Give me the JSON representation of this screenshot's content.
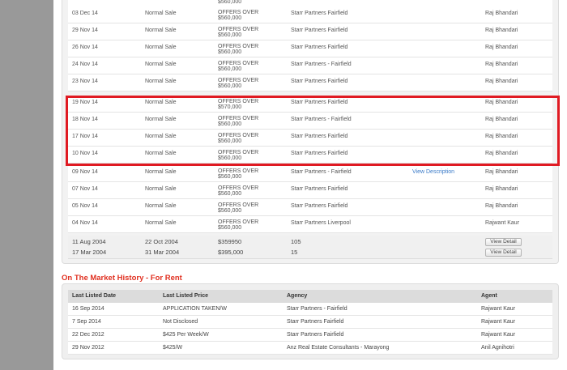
{
  "sale_rows": [
    {
      "date": "03 Dec 14",
      "type": "Normal Sale",
      "price_line1": "OFFERS OVER",
      "price_line2": "$560,000",
      "agency": "Starr Partners Fairfield",
      "link": "",
      "agent": "Raj Bhandari"
    },
    {
      "date": "29 Nov 14",
      "type": "Normal Sale",
      "price_line1": "OFFERS OVER",
      "price_line2": "$560,000",
      "agency": "Starr Partners Fairfield",
      "link": "",
      "agent": "Raj Bhandari"
    },
    {
      "date": "26 Nov 14",
      "type": "Normal Sale",
      "price_line1": "OFFERS OVER",
      "price_line2": "$560,000",
      "agency": "Starr Partners Fairfield",
      "link": "",
      "agent": "Raj Bhandari"
    },
    {
      "date": "24 Nov 14",
      "type": "Normal Sale",
      "price_line1": "OFFERS OVER",
      "price_line2": "$560,000",
      "agency": "Starr Partners - Fairfield",
      "link": "",
      "agent": "Raj Bhandari"
    },
    {
      "date": "23 Nov 14",
      "type": "Normal Sale",
      "price_line1": "OFFERS OVER",
      "price_line2": "$560,000",
      "agency": "Starr Partners Fairfield",
      "link": "",
      "agent": "Raj Bhandari"
    },
    {
      "date": "19 Nov 14",
      "type": "Normal Sale",
      "price_line1": "OFFERS OVER",
      "price_line2": "$570,000",
      "agency": "Starr Partners Fairfield",
      "link": "",
      "agent": "Raj Bhandari"
    },
    {
      "date": "18 Nov 14",
      "type": "Normal Sale",
      "price_line1": "OFFERS OVER",
      "price_line2": "$560,000",
      "agency": "Starr Partners - Fairfield",
      "link": "",
      "agent": "Raj Bhandari"
    },
    {
      "date": "17 Nov 14",
      "type": "Normal Sale",
      "price_line1": "OFFERS OVER",
      "price_line2": "$560,000",
      "agency": "Starr Partners Fairfield",
      "link": "",
      "agent": "Raj Bhandari"
    },
    {
      "date": "10 Nov 14",
      "type": "Normal Sale",
      "price_line1": "OFFERS OVER",
      "price_line2": "$560,000",
      "agency": "Starr Partners Fairfield",
      "link": "",
      "agent": "Raj Bhandari"
    },
    {
      "date": "09 Nov 14",
      "type": "Normal Sale",
      "price_line1": "OFFERS OVER",
      "price_line2": "$560,000",
      "agency": "Starr Partners - Fairfield",
      "link": "View Description",
      "agent": "Raj Bhandari"
    },
    {
      "date": "07 Nov 14",
      "type": "Normal Sale",
      "price_line1": "OFFERS OVER",
      "price_line2": "$560,000",
      "agency": "Starr Partners Fairfield",
      "link": "",
      "agent": "Raj Bhandari"
    },
    {
      "date": "05 Nov 14",
      "type": "Normal Sale",
      "price_line1": "OFFERS OVER",
      "price_line2": "$560,000",
      "agency": "Starr Partners Fairfield",
      "link": "",
      "agent": "Raj Bhandari"
    },
    {
      "date": "04 Nov 14",
      "type": "Normal Sale",
      "price_line1": "OFFERS OVER",
      "price_line2": "$560,000",
      "agency": "Starr Partners Liverpool",
      "link": "",
      "agent": "Rajwant Kaur"
    }
  ],
  "sale_summary_rows": [
    {
      "listed": "11 Aug 2004",
      "sold": "22 Oct 2004",
      "price": "$359950",
      "days": "105",
      "button": "View Detail"
    },
    {
      "listed": "17 Mar 2004",
      "sold": "31 Mar 2004",
      "price": "$395,000",
      "days": "15",
      "button": "View Detail"
    }
  ],
  "rent_section": {
    "title": "On The Market History - For Rent",
    "headers": [
      "Last Listed Date",
      "Last Listed Price",
      "Agency",
      "Agent"
    ],
    "rows": [
      [
        "16 Sep 2014",
        "APPLICATION TAKEN/W",
        "Starr Partners - Fairfield",
        "Rajwant Kaur"
      ],
      [
        "7 Sep 2014",
        "Not Disclosed",
        "Starr Partners Fairfield",
        "Rajwant Kaur"
      ],
      [
        "22 Dec 2012",
        "$425 Per Week/W",
        "Starr Partners Fairfield",
        "Rajwant Kaur"
      ],
      [
        "29 Nov 2012",
        "$425/W",
        "Anz Real Estate Consultants - Marayong",
        "Anil Agnihotri"
      ]
    ]
  },
  "colors": {
    "highlight": "#e01a22",
    "section_title": "#e03020",
    "link": "#3a7ac8",
    "sidebar": "#999999"
  }
}
